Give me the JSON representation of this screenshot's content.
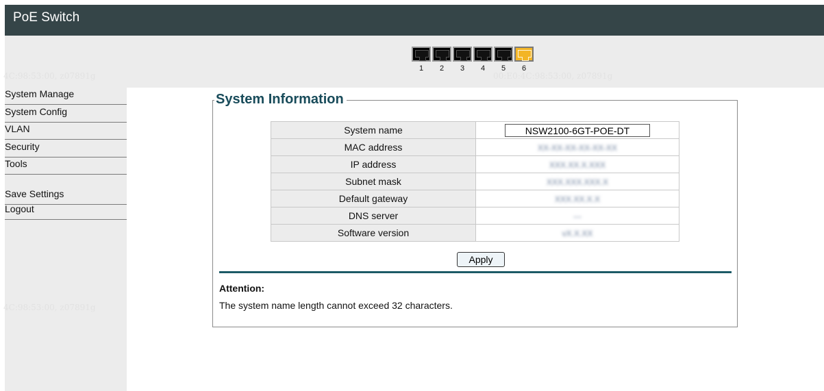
{
  "header": {
    "title": "PoE Switch"
  },
  "ports": {
    "labels": [
      "1",
      "2",
      "3",
      "4",
      "5",
      "6"
    ],
    "states": [
      "inactive",
      "inactive",
      "inactive",
      "inactive",
      "inactive",
      "active"
    ],
    "active_color": "#f3b526"
  },
  "sidebar": {
    "items": [
      {
        "label": "System Manage"
      },
      {
        "label": "System Config"
      },
      {
        "label": "VLAN"
      },
      {
        "label": "Security"
      },
      {
        "label": "Tools"
      },
      {
        "label": "Save Settings"
      },
      {
        "label": "Logout"
      }
    ]
  },
  "watermark": {
    "text_left": "4C:98:53:00, z07891g",
    "text_right": "00:E0:4C:98:53:00, z07891g"
  },
  "panel": {
    "title": "System Information",
    "rows": [
      {
        "label": "System name",
        "value": "NSW2100-6GT-POE-DT"
      },
      {
        "label": "MAC address",
        "value": "XX-XX-XX-XX-XX-XX"
      },
      {
        "label": "IP address",
        "value": "XXX.XX.X.XXX"
      },
      {
        "label": "Subnet mask",
        "value": "XXX.XXX.XXX.X"
      },
      {
        "label": "Default gateway",
        "value": "XXX.XX.X.X"
      },
      {
        "label": "DNS server",
        "value": "---"
      },
      {
        "label": "Software version",
        "value": "vX.X.XX"
      }
    ],
    "apply_label": "Apply",
    "attention_title": "Attention:",
    "attention_text": "The system name length cannot exceed 32 characters."
  },
  "colors": {
    "header_bg": "#354548",
    "title_color": "#184b5a",
    "divider_color": "#1c5a66",
    "sidebar_bg": "#ececec"
  }
}
